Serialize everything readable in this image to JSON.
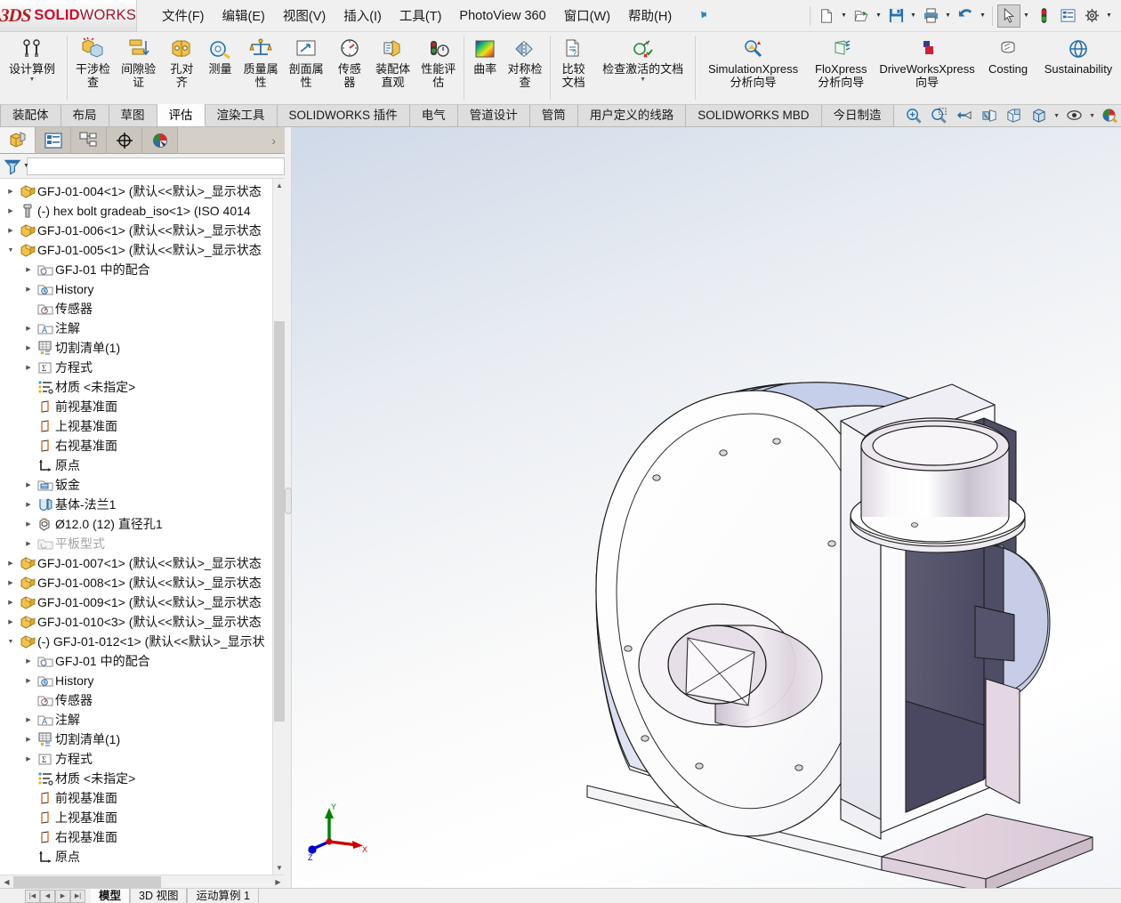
{
  "menubar": {
    "logo": {
      "brand_3ds": "3DS",
      "brand_solid": "SOLID",
      "brand_works": "WORKS"
    },
    "items": [
      {
        "label": "文件(F)",
        "name": "menu-file"
      },
      {
        "label": "编辑(E)",
        "name": "menu-edit"
      },
      {
        "label": "视图(V)",
        "name": "menu-view"
      },
      {
        "label": "插入(I)",
        "name": "menu-insert"
      },
      {
        "label": "工具(T)",
        "name": "menu-tools"
      },
      {
        "label": "PhotoView 360",
        "name": "menu-photoview"
      },
      {
        "label": "窗口(W)",
        "name": "menu-window"
      },
      {
        "label": "帮助(H)",
        "name": "menu-help"
      }
    ],
    "pin": "pin-icon",
    "quick_access": [
      {
        "name": "new-document-icon",
        "caret": true
      },
      {
        "name": "open-document-icon",
        "caret": true
      },
      {
        "name": "save-icon",
        "caret": true
      },
      {
        "name": "print-icon",
        "caret": true
      },
      {
        "name": "undo-icon",
        "caret": true
      },
      {
        "name": "select-cursor-icon",
        "caret": true,
        "selected": true
      },
      {
        "name": "rebuild-icon",
        "caret": false
      },
      {
        "name": "options-list-icon",
        "caret": false
      },
      {
        "name": "settings-gear-icon",
        "caret": true
      }
    ]
  },
  "ribbon": {
    "groups": [
      {
        "name": "design-study-group",
        "buttons": [
          {
            "label": "设计算例",
            "icon": "design-study-icon",
            "name": "design-study-button",
            "caret": true,
            "wide": "w2"
          }
        ]
      },
      {
        "name": "evaluate-group",
        "buttons": [
          {
            "label": "干涉检查",
            "icon": "interference-detection-icon",
            "name": "interference-detection-button"
          },
          {
            "label": "间隙验证",
            "icon": "clearance-verification-icon",
            "name": "clearance-verification-button"
          },
          {
            "label": "孔对齐",
            "icon": "hole-alignment-icon",
            "name": "hole-alignment-button"
          },
          {
            "label": "测量",
            "icon": "measure-icon",
            "name": "measure-button"
          },
          {
            "label": "质量属性",
            "icon": "mass-properties-icon",
            "name": "mass-properties-button"
          },
          {
            "label": "剖面属性",
            "icon": "section-properties-icon",
            "name": "section-properties-button"
          },
          {
            "label": "传感器",
            "icon": "sensor-icon",
            "name": "sensor-button"
          },
          {
            "label": "装配体直观",
            "icon": "assembly-visualization-icon",
            "name": "assembly-visualization-button"
          },
          {
            "label": "性能评估",
            "icon": "performance-evaluation-icon",
            "name": "performance-evaluation-button"
          }
        ]
      },
      {
        "name": "curvature-group",
        "buttons": [
          {
            "label": "曲率",
            "icon": "curvature-icon",
            "name": "curvature-button"
          },
          {
            "label": "对称检查",
            "icon": "symmetry-check-icon",
            "name": "symmetry-check-button"
          }
        ]
      },
      {
        "name": "compare-group",
        "buttons": [
          {
            "label": "比较文档",
            "icon": "compare-documents-icon",
            "name": "compare-documents-button"
          },
          {
            "label": "检查激活的文档",
            "icon": "check-active-document-icon",
            "name": "check-active-document-button",
            "caret": true,
            "wide": "wide"
          }
        ]
      },
      {
        "name": "xpress-group",
        "buttons": [
          {
            "label": "SimulationXpress 分析向导",
            "icon": "simulationxpress-icon",
            "name": "simulationxpress-button",
            "wide": "wide"
          },
          {
            "label": "FloXpress 分析向导",
            "icon": "floxpress-icon",
            "name": "floxpress-button",
            "wide": "w2"
          },
          {
            "label": "DriveWorksXpress 向导",
            "icon": "driveworksxpress-icon",
            "name": "driveworksxpress-button",
            "wide": "wide"
          },
          {
            "label": "Costing",
            "icon": "costing-icon",
            "name": "costing-button",
            "wide": "w2"
          },
          {
            "label": "Sustainability",
            "icon": "sustainability-icon",
            "name": "sustainability-button",
            "wide": "wide"
          }
        ]
      }
    ]
  },
  "command_tabs": {
    "tabs": [
      {
        "label": "装配体",
        "name": "tab-assembly",
        "active": false
      },
      {
        "label": "布局",
        "name": "tab-layout",
        "active": false
      },
      {
        "label": "草图",
        "name": "tab-sketch",
        "active": false
      },
      {
        "label": "评估",
        "name": "tab-evaluate",
        "active": true
      },
      {
        "label": "渲染工具",
        "name": "tab-render-tools",
        "active": false
      },
      {
        "label": "SOLIDWORKS 插件",
        "name": "tab-solidworks-addins",
        "active": false
      },
      {
        "label": "电气",
        "name": "tab-electrical",
        "active": false
      },
      {
        "label": "管道设计",
        "name": "tab-piping-design",
        "active": false
      },
      {
        "label": "管筒",
        "name": "tab-tubing",
        "active": false
      },
      {
        "label": "用户定义的线路",
        "name": "tab-custom-routes",
        "active": false
      },
      {
        "label": "SOLIDWORKS MBD",
        "name": "tab-solidworks-mbd",
        "active": false
      },
      {
        "label": "今日制造",
        "name": "tab-manufacturing-today",
        "active": false
      }
    ],
    "view_tools": [
      {
        "name": "zoom-to-fit-icon",
        "caret": false
      },
      {
        "name": "zoom-area-icon",
        "caret": false
      },
      {
        "name": "previous-view-icon",
        "caret": false
      },
      {
        "name": "section-view-icon",
        "caret": false
      },
      {
        "name": "view-orientation-icon",
        "caret": false
      },
      {
        "name": "display-style-icon",
        "caret": true
      },
      {
        "name": "hide-show-items-icon",
        "caret": true
      },
      {
        "name": "view-settings-icon",
        "caret": true
      },
      {
        "name": "appearances-icon",
        "caret": false
      },
      {
        "name": "apply-scene-icon",
        "caret": true
      }
    ]
  },
  "feature_tree": {
    "panel_tabs": [
      {
        "name": "feature-manager-tab",
        "icon": "feature-tree-icon",
        "active": true
      },
      {
        "name": "property-manager-tab",
        "icon": "property-manager-icon",
        "active": false
      },
      {
        "name": "configuration-manager-tab",
        "icon": "configuration-manager-icon",
        "active": false
      },
      {
        "name": "dimxpert-manager-tab",
        "icon": "dimxpert-icon",
        "active": false
      },
      {
        "name": "display-manager-tab",
        "icon": "display-manager-icon",
        "active": false
      }
    ],
    "panel_expand": "chevron-right-icon",
    "filter": {
      "name": "filter-icon",
      "placeholder": ""
    },
    "nodes": [
      {
        "indent": 0,
        "twisty": "closed",
        "icon": "part-icon",
        "label": "GFJ-01-004<1>  (默认<<默认>_显示状态"
      },
      {
        "indent": 0,
        "twisty": "closed",
        "icon": "bolt-icon",
        "label": "(-) hex bolt gradeab_iso<1>  (ISO 4014"
      },
      {
        "indent": 0,
        "twisty": "closed",
        "icon": "part-icon",
        "label": "GFJ-01-006<1>  (默认<<默认>_显示状态"
      },
      {
        "indent": 0,
        "twisty": "open",
        "icon": "part-icon",
        "label": "GFJ-01-005<1>  (默认<<默认>_显示状态"
      },
      {
        "indent": 1,
        "twisty": "closed",
        "icon": "mates-folder-icon",
        "label": "GFJ-01 中的配合"
      },
      {
        "indent": 1,
        "twisty": "closed",
        "icon": "history-folder-icon",
        "label": "History"
      },
      {
        "indent": 1,
        "twisty": "none",
        "icon": "sensors-folder-icon",
        "label": "传感器"
      },
      {
        "indent": 1,
        "twisty": "closed",
        "icon": "annotations-folder-icon",
        "label": "注解"
      },
      {
        "indent": 1,
        "twisty": "closed",
        "icon": "cut-list-icon",
        "label": "切割清单(1)"
      },
      {
        "indent": 1,
        "twisty": "closed",
        "icon": "equations-icon",
        "label": "方程式"
      },
      {
        "indent": 1,
        "twisty": "none",
        "icon": "material-icon",
        "label": "材质 <未指定>"
      },
      {
        "indent": 1,
        "twisty": "none",
        "icon": "plane-icon",
        "label": "前视基准面"
      },
      {
        "indent": 1,
        "twisty": "none",
        "icon": "plane-icon",
        "label": "上视基准面"
      },
      {
        "indent": 1,
        "twisty": "none",
        "icon": "plane-icon",
        "label": "右视基准面"
      },
      {
        "indent": 1,
        "twisty": "none",
        "icon": "origin-icon",
        "label": "原点"
      },
      {
        "indent": 1,
        "twisty": "closed",
        "icon": "sheetmetal-icon",
        "label": "钣金"
      },
      {
        "indent": 1,
        "twisty": "closed",
        "icon": "base-flange-icon",
        "label": "基体-法兰1"
      },
      {
        "indent": 1,
        "twisty": "closed",
        "icon": "hole-icon",
        "label": "Ø12.0 (12) 直径孔1"
      },
      {
        "indent": 1,
        "twisty": "closed",
        "icon": "flat-pattern-icon",
        "label": "平板型式",
        "dim": true
      },
      {
        "indent": 0,
        "twisty": "closed",
        "icon": "part-icon",
        "label": "GFJ-01-007<1>  (默认<<默认>_显示状态"
      },
      {
        "indent": 0,
        "twisty": "closed",
        "icon": "part-icon",
        "label": "GFJ-01-008<1>  (默认<<默认>_显示状态"
      },
      {
        "indent": 0,
        "twisty": "closed",
        "icon": "part-icon",
        "label": "GFJ-01-009<1>  (默认<<默认>_显示状态"
      },
      {
        "indent": 0,
        "twisty": "closed",
        "icon": "part-icon",
        "label": "GFJ-01-010<3>  (默认<<默认>_显示状态"
      },
      {
        "indent": 0,
        "twisty": "open",
        "icon": "part-icon",
        "label": "(-) GFJ-01-012<1>  (默认<<默认>_显示状"
      },
      {
        "indent": 1,
        "twisty": "closed",
        "icon": "mates-folder-icon",
        "label": "GFJ-01 中的配合"
      },
      {
        "indent": 1,
        "twisty": "closed",
        "icon": "history-folder-icon",
        "label": "History"
      },
      {
        "indent": 1,
        "twisty": "none",
        "icon": "sensors-folder-icon",
        "label": "传感器"
      },
      {
        "indent": 1,
        "twisty": "closed",
        "icon": "annotations-folder-icon",
        "label": "注解"
      },
      {
        "indent": 1,
        "twisty": "closed",
        "icon": "cut-list-icon",
        "label": "切割清单(1)"
      },
      {
        "indent": 1,
        "twisty": "closed",
        "icon": "equations-icon",
        "label": "方程式"
      },
      {
        "indent": 1,
        "twisty": "none",
        "icon": "material-icon",
        "label": "材质 <未指定>"
      },
      {
        "indent": 1,
        "twisty": "none",
        "icon": "plane-icon",
        "label": "前视基准面"
      },
      {
        "indent": 1,
        "twisty": "none",
        "icon": "plane-icon",
        "label": "上视基准面"
      },
      {
        "indent": 1,
        "twisty": "none",
        "icon": "plane-icon",
        "label": "右视基准面"
      },
      {
        "indent": 1,
        "twisty": "none",
        "icon": "origin-icon",
        "label": "原点"
      }
    ]
  },
  "graphics": {
    "triad": {
      "x_label": "X",
      "y_label": "Y",
      "z_label": "Z",
      "x_color": "#cc0000",
      "y_color": "#008000",
      "z_color": "#0000cc"
    },
    "model_name": "centrifugal-blower-assembly"
  },
  "bottom_bar": {
    "nav_buttons": [
      "first-page-icon",
      "previous-page-icon",
      "next-page-icon",
      "last-page-icon"
    ],
    "tabs": [
      {
        "label": "模型",
        "name": "bottom-tab-model",
        "active": true
      },
      {
        "label": "3D 视图",
        "name": "bottom-tab-3dview",
        "active": false
      },
      {
        "label": "运动算例 1",
        "name": "bottom-tab-motion-study",
        "active": false
      }
    ]
  }
}
